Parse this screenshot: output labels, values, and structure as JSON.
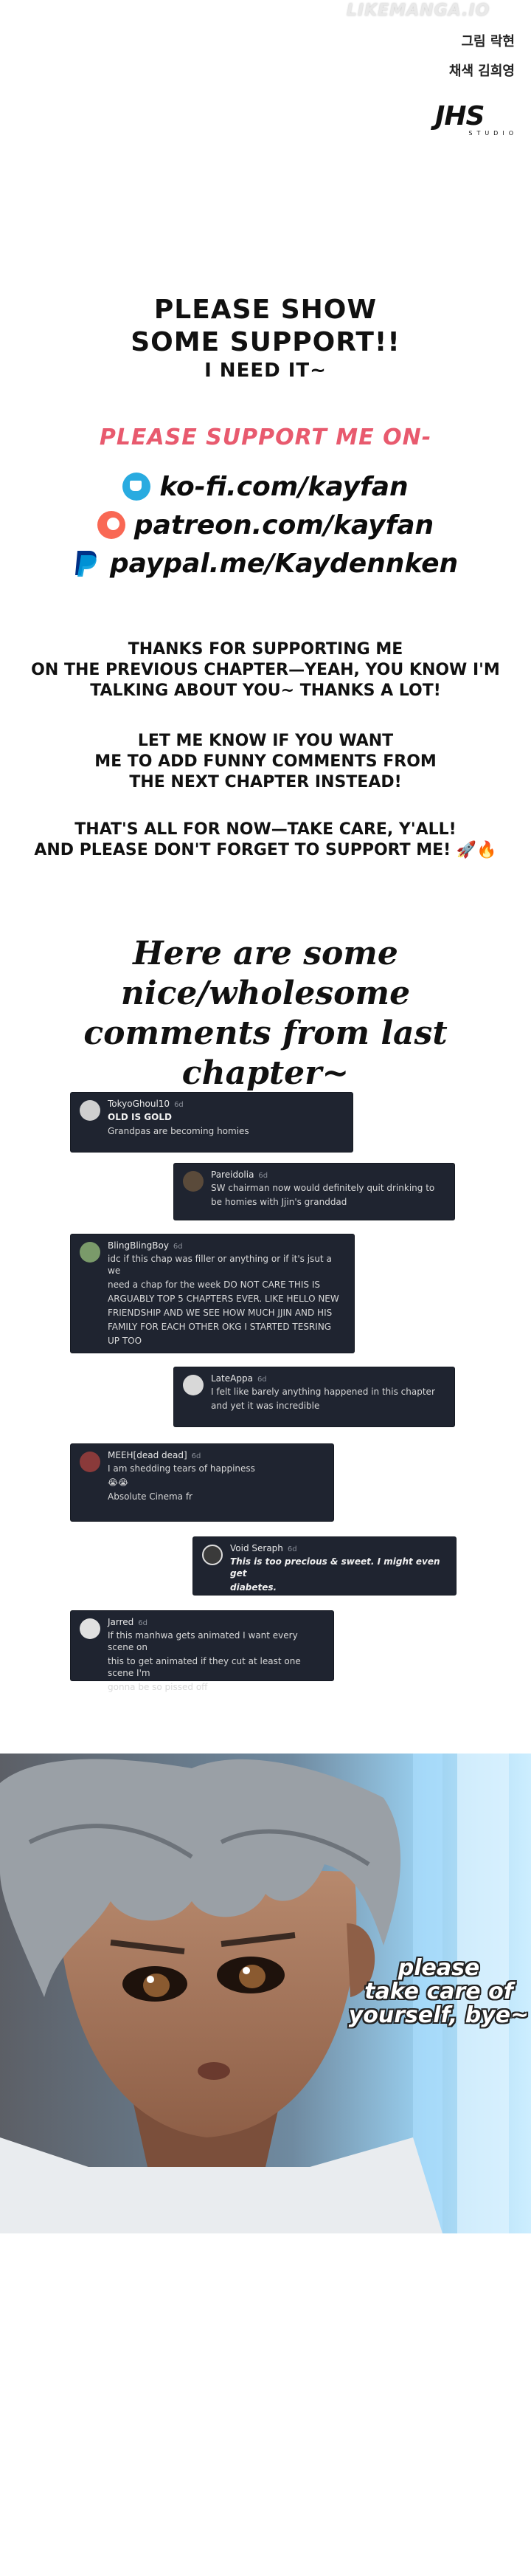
{
  "credits": {
    "watermark": "LIKEMANGA.IO",
    "line1": "그림 락현",
    "line2": "채색 김희영",
    "logo": "JHS",
    "logo_sub": "STUDIO"
  },
  "support": {
    "heading_line1": "PLEASE SHOW",
    "heading_line2": "SOME SUPPORT!!",
    "heading_line3": "I NEED IT~",
    "support_me": "PLEASE SUPPORT ME ON-",
    "links": [
      {
        "icon": "ko-fi-icon",
        "text": "ko-fi.com/kayfan"
      },
      {
        "icon": "patreon-icon",
        "text": "patreon.com/kayfan"
      },
      {
        "icon": "paypal-icon",
        "text": "paypal.me/Kaydennken"
      }
    ]
  },
  "thanks": {
    "p1_l1": "THANKS FOR SUPPORTING ME",
    "p1_l2": "ON THE PREVIOUS CHAPTER—YEAH, YOU KNOW I'M",
    "p1_l3": "TALKING ABOUT YOU~ THANKS A LOT!",
    "p2_l1": "LET ME KNOW IF YOU WANT",
    "p2_l2": "ME TO ADD FUNNY COMMENTS FROM",
    "p2_l3": "THE NEXT CHAPTER INSTEAD!",
    "p3_l1": "THAT'S ALL FOR NOW—TAKE CARE, Y'ALL!",
    "p3_l2": "AND PLEASE DON'T FORGET TO SUPPORT ME! 🚀🔥"
  },
  "nice_heading": {
    "line1": "Here are some nice/wholesome",
    "line2": "comments from last chapter~"
  },
  "comments": [
    {
      "user": "TokyoGhoul10",
      "time": "6d",
      "lines": [
        "OLD IS GOLD",
        "Grandpas are becoming homies"
      ]
    },
    {
      "user": "Pareidolia",
      "time": "6d",
      "lines": [
        "SW chairman now would definitely quit drinking to",
        "be homies with Jjin's granddad"
      ]
    },
    {
      "user": "BlingBlingBoy",
      "time": "6d",
      "lines": [
        "idc if this chap was filler or anything or if it's jsut a we",
        "need a chap for the week DO NOT CARE THIS IS",
        "ARGUABLY TOP 5 CHAPTERS EVER. LIKE HELLO NEW",
        "FRIENDSHIP AND WE SEE HOW MUCH JJIN AND HIS",
        "FAMILY FOR EACH OTHER OKG I STARTED TESRING",
        "UP TOO"
      ]
    },
    {
      "user": "LateAppa",
      "time": "6d",
      "lines": [
        "I felt like barely anything happened in this chapter",
        "and yet it was incredible"
      ]
    },
    {
      "user": "MEEH[dead dead]",
      "time": "6d",
      "lines": [
        "I am shedding tears of happiness",
        "😭😭",
        "Absolute Cinema fr"
      ]
    },
    {
      "user": "Void Seraph",
      "time": "6d",
      "lines": [
        "This is too precious & sweet. I might even get",
        "diabetes."
      ]
    },
    {
      "user": "Jarred",
      "time": "6d",
      "lines": [
        "If this manhwa gets animated I want every scene on",
        "this to get animated if they cut at least one scene I'm",
        "gonna be so pissed off"
      ]
    }
  ],
  "speech_bubble": {
    "line1": "please",
    "line2": "take care of",
    "line3": "yourself, bye~"
  },
  "colors": {
    "accent_pink": "#e85a6e",
    "card_bg": "#1f2430",
    "kofi": "#29abe0",
    "patreon": "#f96854"
  }
}
